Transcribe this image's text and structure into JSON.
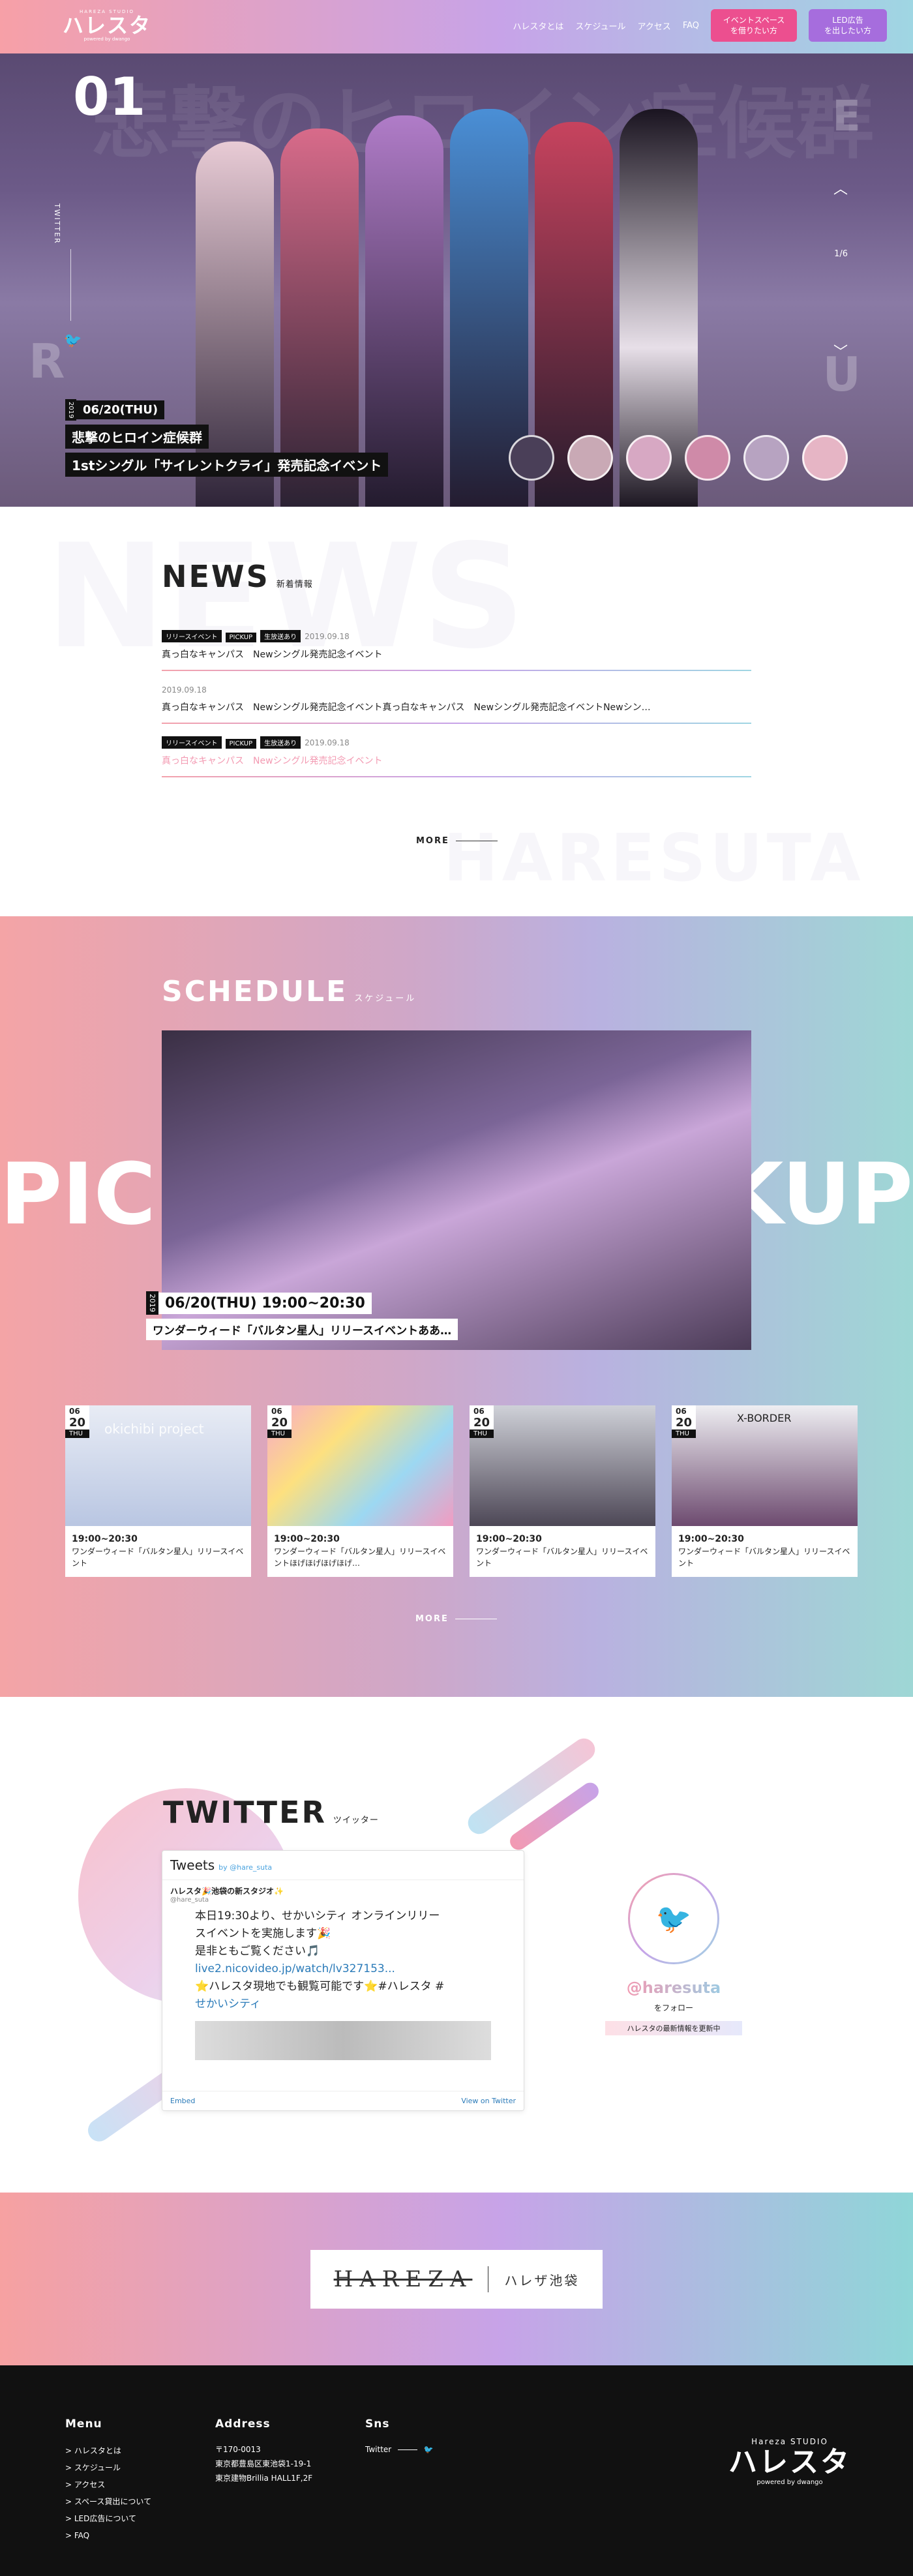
{
  "header": {
    "logo_small": "HAREZA STUDIO",
    "logo_text": "ハレスタ",
    "logo_sub": "powered by dwango",
    "nav": [
      "ハレスタとは",
      "スケジュール",
      "アクセス",
      "FAQ"
    ],
    "cta_event": "イベントスペース\nを借りたい方",
    "cta_led": "LED広告\nを出したい方"
  },
  "hero": {
    "number": "01",
    "bg_text": "悲撃のヒロイン症候群",
    "twitter_label": "TWITTER",
    "side_left": "R",
    "side_right": "U",
    "side_top": "E",
    "page_indicator": "1/6",
    "year": "2019",
    "date": "06/20(THU)",
    "title_line1": "悲撃のヒロイン症候群",
    "title_line2": "1stシングル「サイレントクライ」発売記念イベント"
  },
  "news": {
    "heading": "NEWS",
    "subheading": "新着情報",
    "bg_text": "NEWS",
    "bg_text2": "HARESUTA",
    "items": [
      {
        "tags": [
          "リリースイベント",
          "PICKUP",
          "生放送あり"
        ],
        "date": "2019.09.18",
        "title": "真っ白なキャンパス　Newシングル発売記念イベント"
      },
      {
        "tags": [],
        "date": "2019.09.18",
        "title": "真っ白なキャンパス　Newシングル発売記念イベント真っ白なキャンパス　Newシングル発売記念イベントNewシン…"
      },
      {
        "tags": [
          "リリースイベント",
          "PICKUP",
          "生放送あり"
        ],
        "date": "2019.09.18",
        "title": "真っ白なキャンパス　Newシングル発売記念イベント"
      }
    ],
    "more": "MORE"
  },
  "schedule": {
    "heading": "SCHEDULE",
    "subheading": "スケジュール",
    "bg_left": "PIC",
    "bg_right": "KUP",
    "pickup_year": "2019",
    "pickup_date": "06/20(THU) 19:00~20:30",
    "pickup_title": "ワンダーウィード「バルタン星人」リリースイベントああ…",
    "cards": [
      {
        "month": "06",
        "day": "20",
        "wd": "THU",
        "time": "19:00~20:30",
        "desc": "ワンダーウィード「バルタン星人」リリースイベント",
        "img_label": "okichibi project"
      },
      {
        "month": "06",
        "day": "20",
        "wd": "THU",
        "time": "19:00~20:30",
        "desc": "ワンダーウィード「バルタン星人」リリースイベントほげほげほげほげ…",
        "img_label": ""
      },
      {
        "month": "06",
        "day": "20",
        "wd": "THU",
        "time": "19:00~20:30",
        "desc": "ワンダーウィード「バルタン星人」リリースイベント",
        "img_label": ""
      },
      {
        "month": "06",
        "day": "20",
        "wd": "THU",
        "time": "19:00~20:30",
        "desc": "ワンダーウィード「バルタン星人」リリースイベント",
        "img_label": "X-BORDER"
      }
    ],
    "more": "MORE"
  },
  "twitter": {
    "heading": "TWITTER",
    "subheading": "ツイッター",
    "embed_title": "Tweets",
    "embed_by": "by @hare_suta",
    "account_name": "ハレスタ🎉池袋の新スタジオ✨",
    "account_handle": "@hare_suta",
    "tweet_lines": [
      "本日19:30より、せかいシティ オンラインリリー",
      "スイベントを実施します🎉",
      "是非ともご覧ください🎵",
      "live2.nicovideo.jp/watch/lv327153...",
      "⭐ハレスタ現地でも観覧可能です⭐#ハレスタ #",
      "せかいシティ"
    ],
    "embed_footer_left": "Embed",
    "embed_footer_right": "View on Twitter",
    "handle": "@haresuta",
    "follow": "をフォロー",
    "note": "ハレスタの最新情報を更新中"
  },
  "banner": {
    "logo": "HAREZA",
    "jp": "ハレザ池袋"
  },
  "footer": {
    "menu_title": "Menu",
    "menu_items": [
      "> ハレスタとは",
      "> スケジュール",
      "> アクセス",
      "> スペース貸出について",
      "> LED広告について",
      "> FAQ"
    ],
    "address_title": "Address",
    "address_lines": [
      "〒170-0013",
      "東京都豊島区東池袋1-19-1",
      "東京建物Brillia HALL1F,2F"
    ],
    "sns_title": "Sns",
    "sns_twitter": "Twitter",
    "logo_small": "Hareza STUDIO",
    "logo_text": "ハレスタ",
    "logo_sub": "powered by dwango"
  },
  "colors": {
    "gradient_pink": "#f7a0a7",
    "gradient_purple": "#c7a3e8",
    "gradient_cyan": "#9fd6e3",
    "cta_pink": "#ec4f8f",
    "cta_purple": "#a66ddd"
  }
}
